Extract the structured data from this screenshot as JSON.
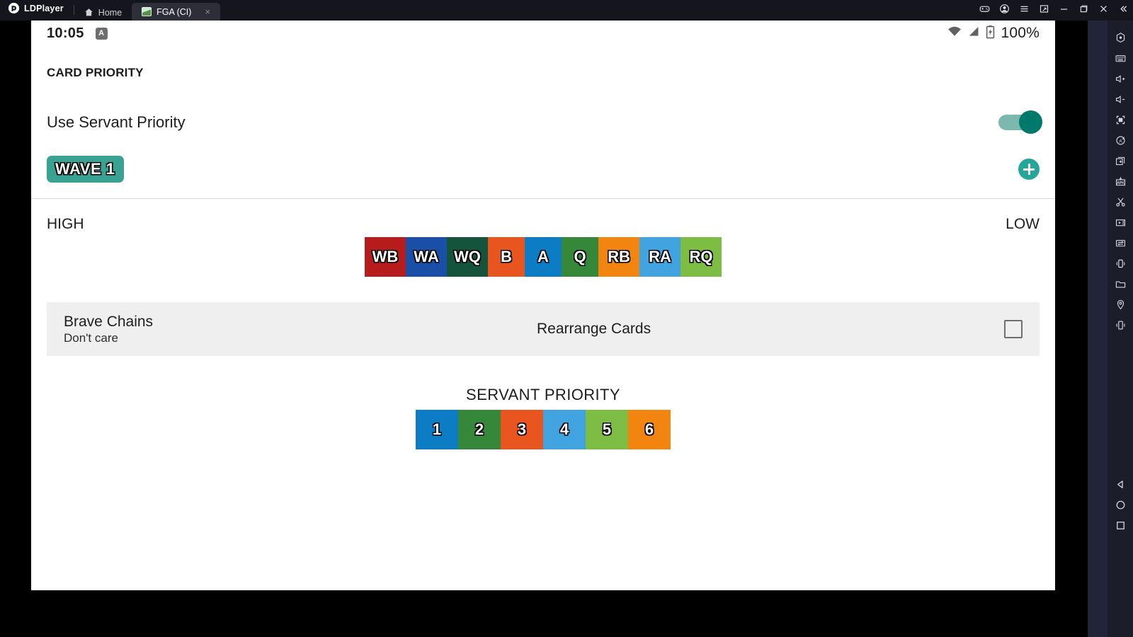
{
  "window": {
    "brand": "LDPlayer",
    "brand_glyph": "Ⓐ",
    "tabs": [
      {
        "label": "Home",
        "icon": "home-icon",
        "active": false
      },
      {
        "label": "FGA (CI)",
        "icon": "app-favicon",
        "active": true,
        "close": "×"
      }
    ],
    "controls": [
      {
        "name": "gamepad-icon",
        "glyph": "🎮"
      },
      {
        "name": "account-icon",
        "glyph": "◉"
      },
      {
        "name": "menu-icon",
        "glyph": "☰"
      },
      {
        "name": "screenshot-icon",
        "glyph": "❐"
      },
      {
        "name": "minimize-button",
        "glyph": "−"
      },
      {
        "name": "maximize-button",
        "glyph": "❐"
      },
      {
        "name": "close-button",
        "glyph": "✕"
      },
      {
        "name": "collapse-button",
        "glyph": "«"
      }
    ]
  },
  "rail": {
    "items": [
      {
        "name": "settings-icon"
      },
      {
        "name": "keyboard-icon"
      },
      {
        "name": "volume-up-icon"
      },
      {
        "name": "volume-down-icon"
      },
      {
        "name": "fullscreen-icon"
      },
      {
        "name": "auto-rotate-icon"
      },
      {
        "name": "multi-instance-icon"
      },
      {
        "name": "install-apk-icon"
      },
      {
        "name": "scissors-icon"
      },
      {
        "name": "video-record-icon"
      },
      {
        "name": "sync-icon"
      },
      {
        "name": "shake-icon"
      },
      {
        "name": "folder-icon"
      },
      {
        "name": "location-icon"
      },
      {
        "name": "vibrate-icon"
      }
    ],
    "nav": [
      {
        "name": "back-button"
      },
      {
        "name": "home-button"
      },
      {
        "name": "recents-button"
      }
    ]
  },
  "status_bar": {
    "time": "10:05",
    "badge": "A",
    "battery_percent": "100%",
    "icons": [
      "wifi-icon",
      "signal-icon",
      "battery-charging-icon"
    ]
  },
  "screen": {
    "section_title": "CARD PRIORITY",
    "use_servant_priority": {
      "label": "Use Servant Priority",
      "enabled": true
    },
    "waves": [
      {
        "label": "WAVE 1",
        "selected": true
      }
    ],
    "add_button_label": "+",
    "priority_scale": {
      "high": "HIGH",
      "low": "LOW"
    },
    "card_tiles": [
      {
        "label": "WB",
        "color": "#b71c1c",
        "wide": true
      },
      {
        "label": "WA",
        "color": "#1a4fa8",
        "wide": true
      },
      {
        "label": "WQ",
        "color": "#14543c",
        "wide": true
      },
      {
        "label": "B",
        "color": "#e8551f",
        "wide": false
      },
      {
        "label": "A",
        "color": "#0c7cc4",
        "wide": false
      },
      {
        "label": "Q",
        "color": "#35873a",
        "wide": false
      },
      {
        "label": "RB",
        "color": "#f28510",
        "wide": true
      },
      {
        "label": "RA",
        "color": "#41a3e0",
        "wide": true
      },
      {
        "label": "RQ",
        "color": "#7dbd44",
        "wide": true
      }
    ],
    "brave_chains": {
      "title": "Brave Chains",
      "value": "Don't care"
    },
    "rearrange_cards": {
      "label": "Rearrange Cards",
      "checked": false
    },
    "servant_priority": {
      "title": "SERVANT PRIORITY",
      "tiles": [
        {
          "label": "1",
          "color": "#0c7cc4"
        },
        {
          "label": "2",
          "color": "#35873a"
        },
        {
          "label": "3",
          "color": "#e8551f"
        },
        {
          "label": "4",
          "color": "#41a3e0"
        },
        {
          "label": "5",
          "color": "#7dbd44"
        },
        {
          "label": "6",
          "color": "#f28510"
        }
      ]
    }
  },
  "colors": {
    "accent_teal": "#26a69a",
    "wave_chip": "#3aa293",
    "card_bg": "#efefef",
    "titlebar": "#15161d",
    "rail_bg": "#1b1d2b"
  }
}
